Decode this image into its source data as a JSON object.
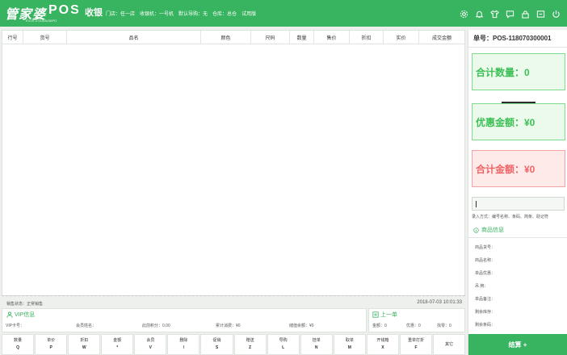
{
  "header": {
    "logo_text": "管家婆",
    "logo_sub": "EVOL.3 GUANJIAPO",
    "logo_pos": "POS",
    "logo_cash": "收银",
    "store_info": [
      "门店：任一店",
      "收银机：一号机",
      "默认导购：无",
      "仓库：总仓",
      "试用版"
    ],
    "icons": [
      "gear-icon",
      "bell-icon",
      "shirt-icon",
      "chat-icon",
      "lock-icon",
      "window-icon",
      "power-icon"
    ]
  },
  "table": {
    "columns": [
      "行号",
      "货号",
      "品名",
      "颜色",
      "尺码",
      "数量",
      "售价",
      "折扣",
      "实价",
      "成交金额"
    ]
  },
  "status": {
    "left": "销售状态：正常销售",
    "datetime": "2018-07-03 10:01:33"
  },
  "vip": {
    "title": "VIP信息",
    "fields": [
      "VIP卡号：",
      "会员姓名：",
      "此前积分：0.00",
      "累计消费：¥0",
      "储值余额：¥0"
    ]
  },
  "last_order": {
    "title": "上一单",
    "fields": [
      "金额：0",
      "优惠：0",
      "找零：0"
    ]
  },
  "keys": [
    {
      "label": "数量",
      "key": "Q"
    },
    {
      "label": "单价",
      "key": "P"
    },
    {
      "label": "折扣",
      "key": "W"
    },
    {
      "label": "金额",
      "key": "*"
    },
    {
      "label": "会员",
      "key": "V"
    },
    {
      "label": "删除",
      "key": "/"
    },
    {
      "label": "促销",
      "key": "S"
    },
    {
      "label": "赠送",
      "key": "Z"
    },
    {
      "label": "导购",
      "key": "L"
    },
    {
      "label": "挂单",
      "key": "N"
    },
    {
      "label": "取单",
      "key": "M"
    },
    {
      "label": "开钱箱",
      "key": "X"
    },
    {
      "label": "重单打折",
      "key": "F"
    },
    {
      "label": "其它",
      "key": ""
    }
  ],
  "right": {
    "order_no": "单号：POS-118070300001",
    "total_qty": "合计数量：0",
    "discount": "优惠金额：¥0",
    "total_amount": "合计金额：¥0",
    "input_tip": "录入方式：编号名称、条码、简条、助记符",
    "product_title": "商品信息",
    "product_fields": [
      "商品货号：",
      "商品名称：",
      "单品优惠：",
      "吊    牌：",
      "单品备注：",
      "剩余库存：",
      "剩余条码："
    ],
    "settle": "结算 +"
  },
  "colors": {
    "brand": "#38b35f",
    "green_box": "#ecfaec",
    "red_box": "#ffeaea"
  }
}
